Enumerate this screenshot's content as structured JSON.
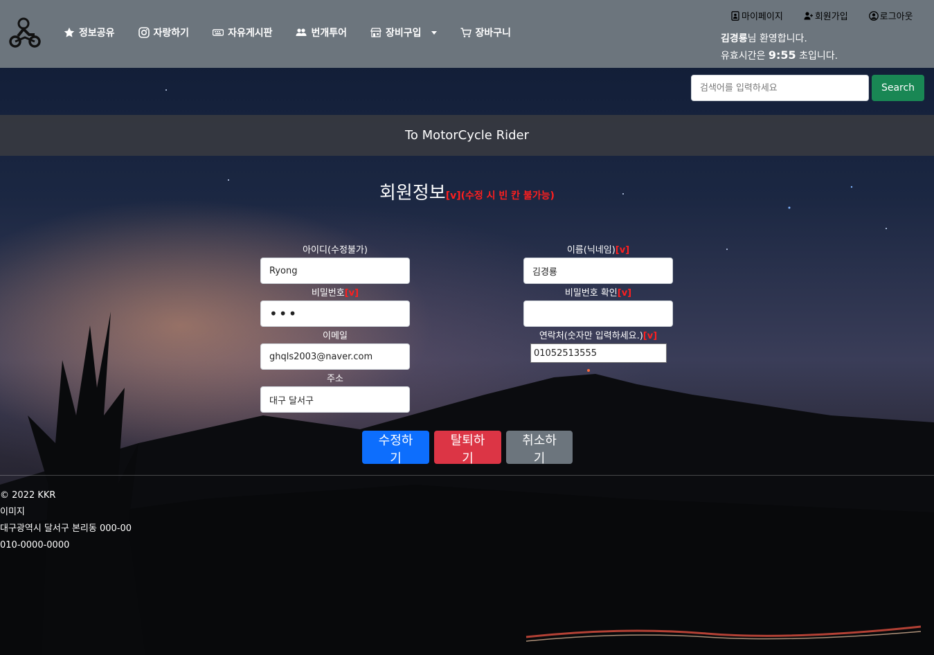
{
  "nav": {
    "items": [
      {
        "label": "정보공유",
        "icon": "star-icon"
      },
      {
        "label": "자랑하기",
        "icon": "instagram-icon"
      },
      {
        "label": "자유게시판",
        "icon": "keyboard-icon"
      },
      {
        "label": "번개투어",
        "icon": "people-icon"
      },
      {
        "label": "장비구입",
        "icon": "shop-icon",
        "dropdown": true
      },
      {
        "label": "장바구니",
        "icon": "cart-icon"
      }
    ],
    "user_links": [
      {
        "label": "마이페이지",
        "icon": "person-badge-icon"
      },
      {
        "label": "회원가입",
        "icon": "person-plus-icon"
      },
      {
        "label": "로그아웃",
        "icon": "person-circle-icon"
      }
    ],
    "welcome_name": "김경룡",
    "welcome_suffix": "님 환영합니다.",
    "session_prefix": "유효시간은 ",
    "session_time": "9:55",
    "session_suffix": " 초입니다."
  },
  "search": {
    "placeholder": "검색어를 입력하세요",
    "button": "Search"
  },
  "banner": {
    "title": "To MotorCycle Rider"
  },
  "form": {
    "title": "회원정보",
    "title_note": "[v](수정 시 빈 칸 불가능)",
    "required_mark": "[v]",
    "id_label": "아이디(수정불가)",
    "id_value": "Ryong",
    "name_label": "이름(닉네임)",
    "name_value": "김경룡",
    "password_label": "비밀번호",
    "password_value": "•••",
    "password_confirm_label": "비밀번호 확인",
    "password_confirm_value": "",
    "email_label": "이메일",
    "email_value": "ghqls2003@naver.com",
    "phone_label": "연락처(숫자만 입력하세요.)",
    "phone_value": "01052513555",
    "address_label": "주소",
    "address_value": "대구 달서구",
    "save_button": "수정하기",
    "withdraw_button": "탈퇴하기",
    "cancel_button": "취소하기"
  },
  "footer": {
    "copyright": "© 2022 KKR",
    "line2": "이미지",
    "address": "대구광역시 달서구 본리동 000-00",
    "phone": "010-0000-0000"
  },
  "colors": {
    "navbar": "#6c757d",
    "search_button": "#198754",
    "banner": "#373a40",
    "primary": "#0d6efd",
    "danger": "#dc3545",
    "secondary": "#6c757d",
    "required": "#ff1f1f"
  }
}
